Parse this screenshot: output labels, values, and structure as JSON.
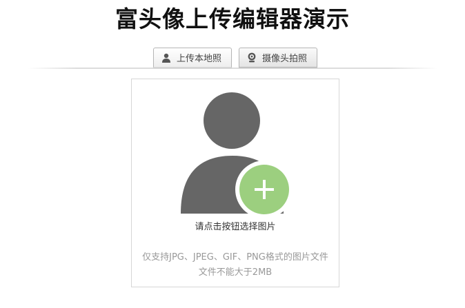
{
  "page": {
    "title": "富头像上传编辑器演示"
  },
  "tabs": [
    {
      "label": "上传本地照",
      "icon": "user-icon",
      "active": true
    },
    {
      "label": "摄像头拍照",
      "icon": "webcam-icon",
      "active": false
    }
  ],
  "upload": {
    "prompt": "请点击按钮选择图片",
    "hint_line1": "仅支持JPG、JPEG、GIF、PNG格式的图片文件",
    "hint_line2": "文件不能大于2MB",
    "avatar_icon": "user-avatar-placeholder-icon",
    "add_icon": "plus-icon"
  },
  "colors": {
    "avatar_gray": "#666666",
    "add_button_green": "#9ccf7f",
    "title_text": "#111111",
    "hint_text": "#999999"
  }
}
